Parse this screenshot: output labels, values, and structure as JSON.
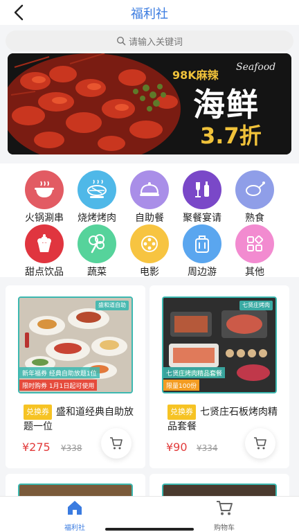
{
  "header": {
    "title": "福利社",
    "back_icon": "back-arrow-icon"
  },
  "search": {
    "placeholder": "请输入关键词",
    "icon": "search-icon"
  },
  "banner": {
    "subtitle": "98K麻辣",
    "script_text": "Seafood",
    "headline": "海鲜",
    "discount": "3.7折"
  },
  "categories": [
    {
      "label": "火锅涮串",
      "icon": "hotpot-icon",
      "color": "#e25b63"
    },
    {
      "label": "烧烤烤肉",
      "icon": "bbq-icon",
      "color": "#4fb8e8"
    },
    {
      "label": "自助餐",
      "icon": "buffet-icon",
      "color": "#a98ee8"
    },
    {
      "label": "聚餐宴请",
      "icon": "banquet-icon",
      "color": "#7a48c8"
    },
    {
      "label": "熟食",
      "icon": "roast-chicken-icon",
      "color": "#8f9ee8"
    },
    {
      "label": "甜点饮品",
      "icon": "cake-icon",
      "color": "#e0353f"
    },
    {
      "label": "蔬菜",
      "icon": "vegetable-icon",
      "color": "#56d39b"
    },
    {
      "label": "电影",
      "icon": "movie-icon",
      "color": "#f7c441"
    },
    {
      "label": "周边游",
      "icon": "luggage-icon",
      "color": "#5aa6ef"
    },
    {
      "label": "其他",
      "icon": "apps-icon",
      "color": "#f28bd0"
    }
  ],
  "products": [
    {
      "badge": "兑换券",
      "name": "盛和道经典自助放题一位",
      "price": "¥275",
      "original_price": "¥338",
      "image_logo": "盛和道自助",
      "image_caption": "新年福券 经典自助放题1位",
      "image_tag": "限时购券 1月1日起可使用"
    },
    {
      "badge": "兑换券",
      "name": "七贤庄石板烤肉精品套餐",
      "price": "¥90",
      "original_price": "¥334",
      "image_logo": "七贤庄烤肉",
      "image_caption": "七贤庄烤肉精品套餐",
      "image_tag": "限量100份"
    }
  ],
  "tabbar": {
    "items": [
      {
        "label": "福利社",
        "icon": "home-icon",
        "active": true,
        "color": "#3a7be0"
      },
      {
        "label": "购物车",
        "icon": "cart-icon",
        "active": false,
        "color": "#666666"
      }
    ]
  }
}
